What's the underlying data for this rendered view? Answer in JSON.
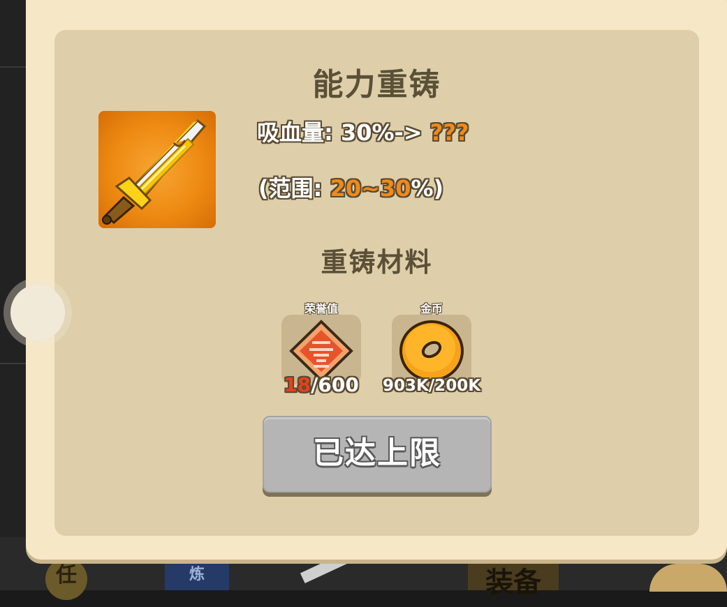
{
  "dialog": {
    "title": "能力重铸",
    "stat": {
      "label": "吸血量: 30%->",
      "next": "???"
    },
    "range": {
      "prefix": "(范围: ",
      "value": "20~30",
      "suffix": "%)"
    },
    "materials_title": "重铸材料",
    "materials": [
      {
        "name": "荣誉值",
        "have": "18",
        "need": "/600",
        "icon": "honor-badge-icon"
      },
      {
        "name": "金币",
        "count": "903K/200K",
        "icon": "gold-coin-icon"
      }
    ],
    "button_label": "已达上限"
  },
  "background": {
    "tab1_glyph": "任",
    "tab2_glyph": "炼",
    "tab4_glyph": "装备"
  },
  "colors": {
    "panel": "#decfaa",
    "dialog": "#f6e8c6",
    "accent_orange": "#f08a1a",
    "need_red": "#e8401a",
    "disabled_button": "#b5b5b5"
  }
}
